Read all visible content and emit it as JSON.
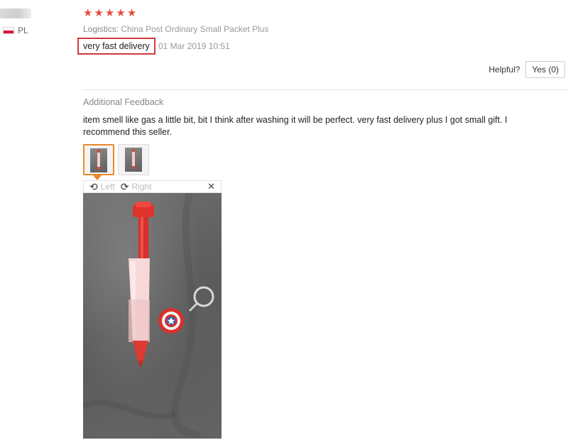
{
  "reviewer": {
    "country_code": "PL"
  },
  "rating": {
    "stars": 5,
    "max": 5,
    "color": "#e74c3c"
  },
  "logistics": {
    "label": "Logistics:",
    "value": "China Post Ordinary Small Packet Plus"
  },
  "review": {
    "text": "very fast delivery",
    "date": "01 Mar 2019 10:51",
    "highlight_color": "#d23a3a"
  },
  "helpful": {
    "label": "Helpful?",
    "button_label": "Yes (0)"
  },
  "additional": {
    "title": "Additional Feedback",
    "text": "item smell like gas a little bit, bit I think after washing it will be perfect. very fast delivery plus I got small gift. I recommend this seller."
  },
  "viewer": {
    "rotate_left_label": "Left",
    "rotate_right_label": "Right",
    "rotate_left_icon": "rotate-left-icon",
    "rotate_right_icon": "rotate-right-icon",
    "close_icon": "close-icon",
    "active_thumb_color": "#e88a2c"
  },
  "photos": {
    "count": 2,
    "active_index": 0
  }
}
